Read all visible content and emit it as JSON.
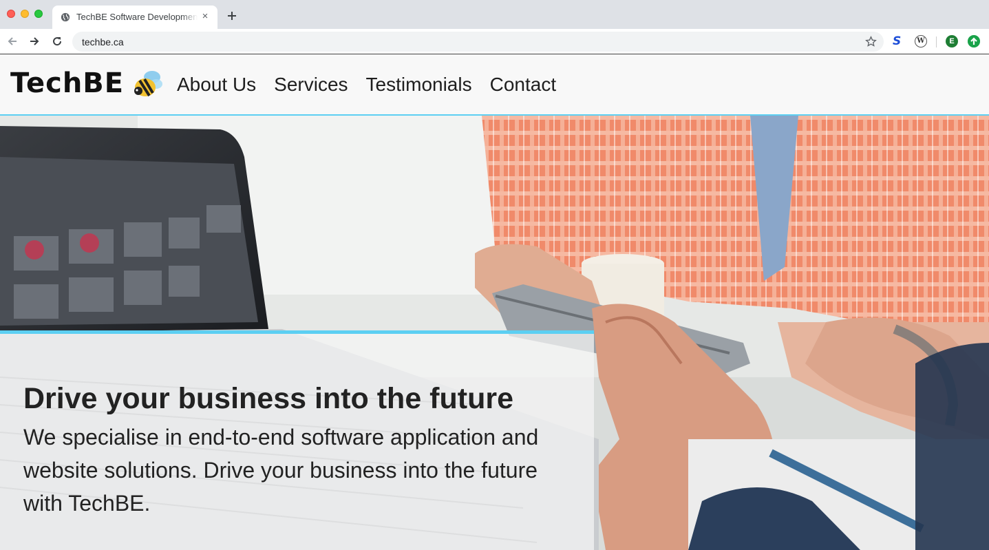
{
  "browser": {
    "tab_title": "TechBE Software Development",
    "tab_close": "×",
    "url": "techbe.ca",
    "extensions": [
      "s-extension-icon",
      "w-extension-icon",
      "profile-e-icon",
      "update-icon"
    ],
    "profile_initial": "E",
    "w_ext_letter": "W",
    "s_ext_letter": "S"
  },
  "site": {
    "logo_text": "TechBE",
    "nav": [
      "About Us",
      "Services",
      "Testimonials",
      "Contact"
    ],
    "accent_color": "#5ccff2"
  },
  "hero": {
    "title": "Drive your business into the future",
    "text": "We specialise in end-to-end software application and website solutions. Drive your business into the future with TechBE."
  }
}
